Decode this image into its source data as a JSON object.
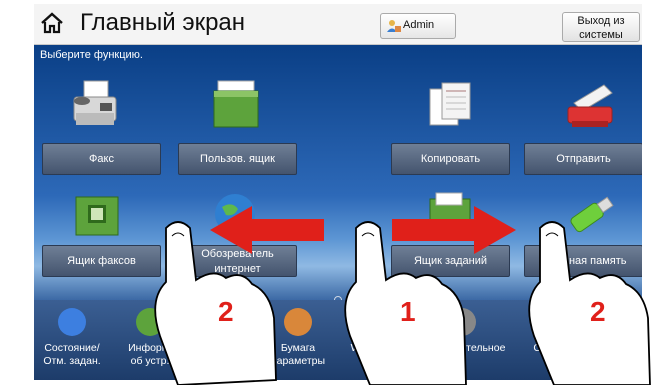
{
  "header": {
    "title": "Главный экран",
    "admin_label": "Admin",
    "logout_label_1": "Выход из",
    "logout_label_2": "системы"
  },
  "prompt": "Выберите функцию.",
  "tiles": [
    {
      "label": "Факс"
    },
    {
      "label": "Пользов. ящик"
    },
    {
      "label": "Копировать"
    },
    {
      "label": "Отправить"
    },
    {
      "label": "Ящик факсов"
    },
    {
      "label_1": "Обозреватель",
      "label_2": "интернет"
    },
    {
      "label": "Ящик заданий"
    },
    {
      "label": "Съемная память"
    }
  ],
  "bottom_bar": [
    {
      "label_1": "Состояние/",
      "label_2": "Отм. задан.",
      "icon": "status-icon"
    },
    {
      "label_1": "Информ.",
      "label_2": "об устр.",
      "icon": "device-info-icon"
    },
    {
      "label_1": "Бумага",
      "label_2": "параметры",
      "icon": "paper-settings-icon"
    },
    {
      "label_1": "Wi-Fi Direct",
      "label_2": "",
      "icon": "wifi-icon"
    },
    {
      "label_1": "Дополнительное",
      "label_2": "",
      "icon": "more-icon"
    },
    {
      "label_1": "Справка",
      "label_2": "",
      "icon": "help-icon"
    }
  ],
  "annotations": {
    "num_left": "2",
    "num_center": "1",
    "num_right": "2"
  },
  "colors": {
    "arrow": "#e0201a",
    "annotation_number": "#e0201a"
  }
}
